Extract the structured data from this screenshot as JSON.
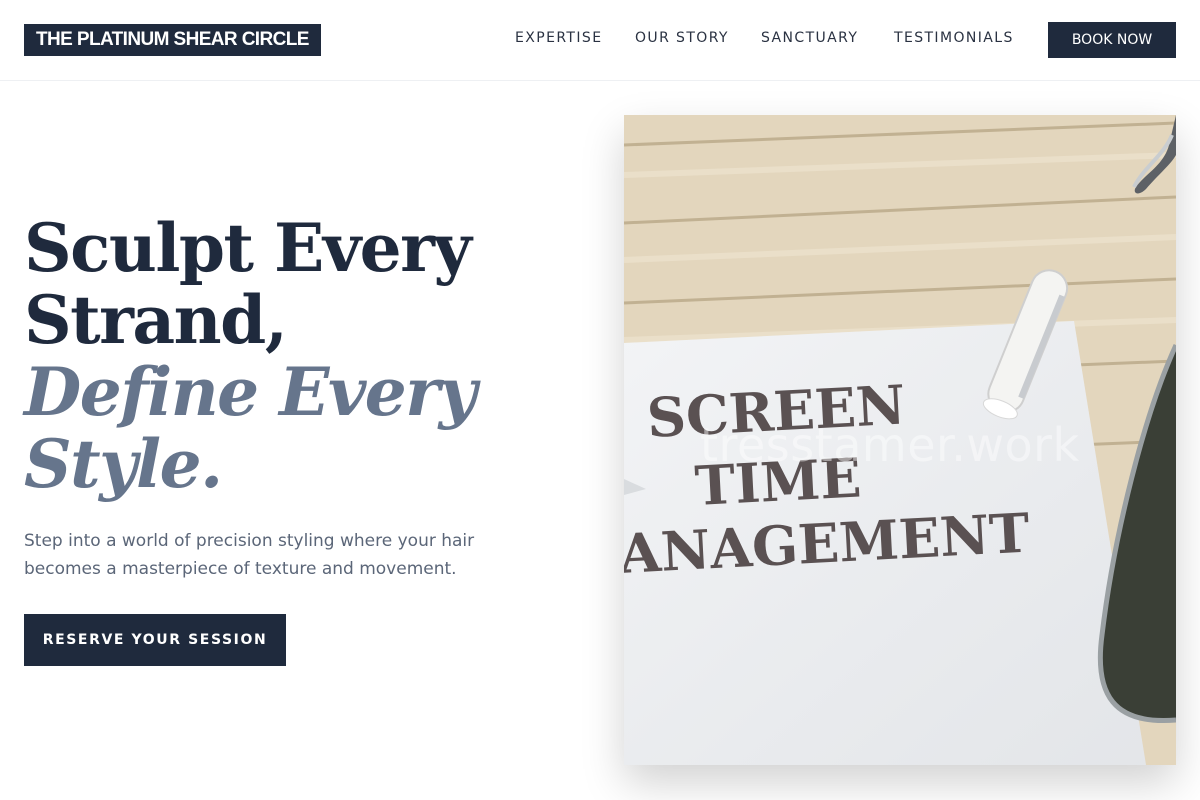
{
  "header": {
    "logo_text": "THE PLATINUM SHEAR CIRCLE",
    "nav": [
      {
        "label": "EXPERTISE"
      },
      {
        "label": "OUR STORY"
      },
      {
        "label": "SANCTUARY"
      },
      {
        "label": "TESTIMONIALS"
      }
    ],
    "book_label": "BOOK NOW"
  },
  "hero": {
    "headline_line1": "Sculpt Every",
    "headline_line2": "Strand,",
    "headline_line3": "Define Every",
    "headline_line4": "Style.",
    "subtext": "Step into a world of precision styling where your hair becomes a masterpiece of texture and movement.",
    "cta_label": "RESERVE YOUR SESSION"
  },
  "image": {
    "paper_line1": "SCREEN",
    "paper_line2": "TIME",
    "paper_line3": "ANAGEMENT",
    "watermark": "tresstamer.work"
  },
  "colors": {
    "primary": "#1f2a3d",
    "accent_muted": "#66758c",
    "body_text": "#5b6678"
  }
}
